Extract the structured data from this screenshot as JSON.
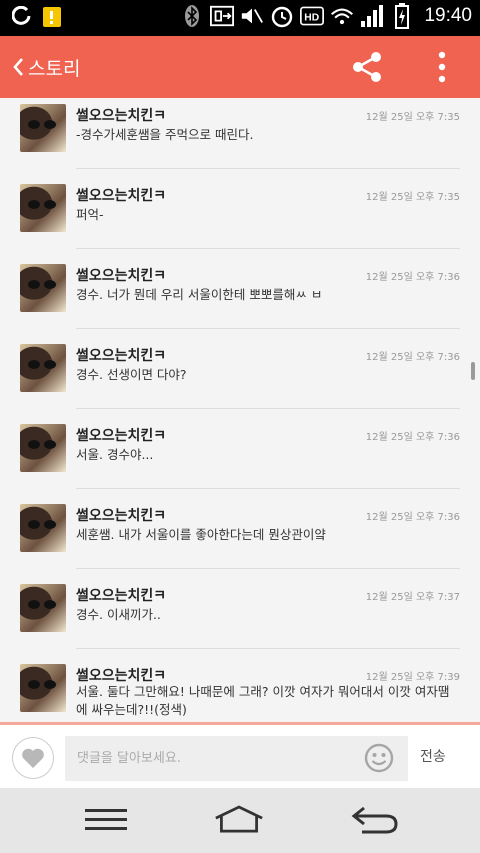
{
  "status_bar": {
    "time": "19:40",
    "icons": [
      "o-app-icon",
      "kakao-notification-icon",
      "bluetooth-icon",
      "nfc-icon",
      "mute-icon",
      "alarm-icon",
      "hd-icon",
      "wifi-icon",
      "signal-icon",
      "battery-charging-icon"
    ]
  },
  "app_bar": {
    "title": "스토리",
    "back_icon": "chevron-left-icon",
    "share_icon": "share-icon",
    "more_icon": "more-vert-icon",
    "background": "#ef6350"
  },
  "comments": [
    {
      "name": "썰오으는치킨ㅋ",
      "time": "12월 25일 오후 7:35",
      "text": "-경수가세훈쌤을 주먹으로 때린다."
    },
    {
      "name": "썰오으는치킨ㅋ",
      "time": "12월 25일 오후 7:35",
      "text": "퍼억-"
    },
    {
      "name": "썰오으는치킨ㅋ",
      "time": "12월 25일 오후 7:36",
      "text": "경수. 너가 뭔데 우리 서울이한테 뽀뽀를해ㅆ ㅂ"
    },
    {
      "name": "썰오으는치킨ㅋ",
      "time": "12월 25일 오후 7:36",
      "text": "경수. 선생이면 다야?"
    },
    {
      "name": "썰오으는치킨ㅋ",
      "time": "12월 25일 오후 7:36",
      "text": "서울. 경수야..."
    },
    {
      "name": "썰오으는치킨ㅋ",
      "time": "12월 25일 오후 7:36",
      "text": "세훈쌤. 내가 서울이를 좋아한다는데 뭔상관이얔"
    },
    {
      "name": "썰오으는치킨ㅋ",
      "time": "12월 25일 오후 7:37",
      "text": "경수. 이새끼가.."
    },
    {
      "name": "썰오으는치킨ㅋ",
      "time": "12월 25일 오후 7:39",
      "text": "서울. 둘다 그만해요! 나때문에 그래? 이깟 여자가 뭐어대서 이깟 여자땜에 싸우는데?!!(정색)"
    }
  ],
  "input": {
    "placeholder": "댓글을 달아보세요.",
    "send_label": "전송",
    "like_icon": "heart-icon",
    "emoji_icon": "smiley-icon"
  },
  "nav_bar": {
    "icons": [
      "menu-icon",
      "home-icon",
      "back-arrow-icon"
    ]
  }
}
